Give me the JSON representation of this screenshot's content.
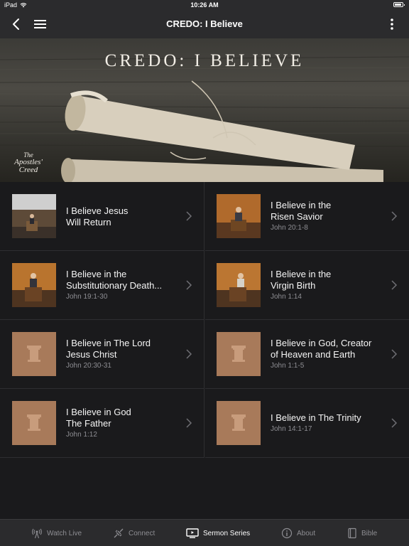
{
  "status_bar": {
    "carrier": "iPad",
    "time": "10:26 AM"
  },
  "nav": {
    "title": "CREDO: I Believe"
  },
  "hero": {
    "title": "CREDO: I BELIEVE",
    "logo_lines": [
      "The",
      "Apostles'",
      "Creed"
    ]
  },
  "sermons": [
    {
      "title_line1": "I Believe Jesus",
      "title_line2": "Will Return",
      "ref": "",
      "thumb": "video-thumbnail"
    },
    {
      "title_line1": "I Believe in the",
      "title_line2": "Risen Savior",
      "ref": "John 20:1-8",
      "thumb": "video-thumbnail"
    },
    {
      "title_line1": "I Believe in the",
      "title_line2": "Substitutionary Death...",
      "ref": "John 19:1-30",
      "thumb": "video-thumbnail"
    },
    {
      "title_line1": "I Believe in the",
      "title_line2": "Virgin Birth",
      "ref": "John 1:14",
      "thumb": "video-thumbnail"
    },
    {
      "title_line1": "I Believe in The Lord",
      "title_line2": "Jesus Christ",
      "ref": "John 20:30-31",
      "thumb": "pillar-placeholder"
    },
    {
      "title_line1": "I Believe in God, Creator",
      "title_line2": "of Heaven and Earth",
      "ref": "John 1:1-5",
      "thumb": "pillar-placeholder"
    },
    {
      "title_line1": "I Believe in God",
      "title_line2": "The Father",
      "ref": "John 1:12",
      "thumb": "pillar-placeholder"
    },
    {
      "title_line1": "I Believe in The Trinity",
      "title_line2": "",
      "ref": "John 14:1-17",
      "thumb": "pillar-placeholder"
    }
  ],
  "tabs": [
    {
      "label": "Watch Live",
      "icon": "broadcast-icon",
      "active": false
    },
    {
      "label": "Connect",
      "icon": "connect-icon",
      "active": false
    },
    {
      "label": "Sermon Series",
      "icon": "tv-icon",
      "active": true
    },
    {
      "label": "About",
      "icon": "info-icon",
      "active": false
    },
    {
      "label": "Bible",
      "icon": "book-icon",
      "active": false
    }
  ],
  "colors": {
    "bar_background": "#2b2b2d",
    "list_background": "#1a1a1c",
    "placeholder_tan": "#a87a5a",
    "secondary_text": "#8e8e93"
  }
}
